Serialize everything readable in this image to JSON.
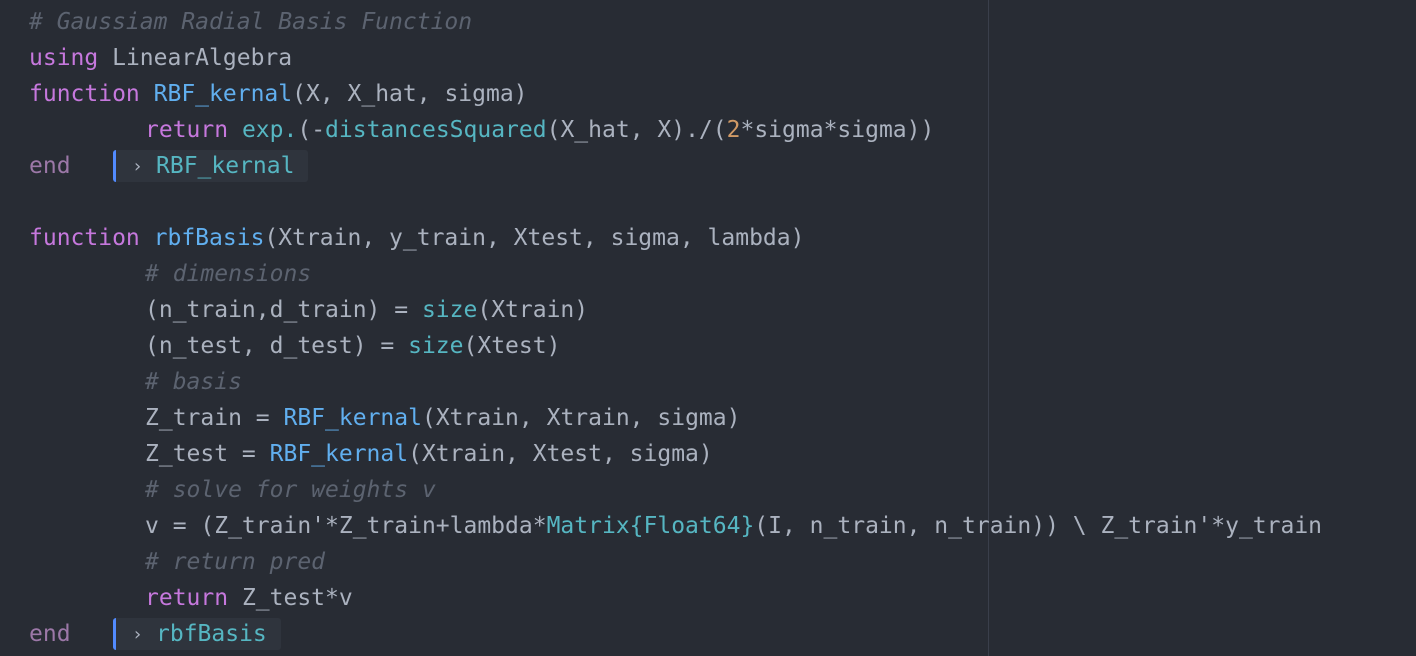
{
  "code": {
    "l1": {
      "comment": "# Gaussiam Radial Basis Function"
    },
    "l2": {
      "kw": "using",
      "rest": " LinearAlgebra"
    },
    "l3": {
      "kw": "function",
      "fn": "RBF_kernal",
      "args": "(X, X_hat, sigma)"
    },
    "l4": {
      "kw": "return",
      "f1": "exp.",
      "p1": "(-",
      "f2": "distancesSquared",
      "p2": "(X_hat, X)./(",
      "num": "2",
      "p3": "*sigma*sigma))"
    },
    "l5": {
      "kw": "end",
      "result": "RBF_kernal"
    },
    "l7": {
      "kw": "function",
      "fn": "rbfBasis",
      "args": "(Xtrain, y_train, Xtest, sigma, lambda)"
    },
    "l8": {
      "comment": "# dimensions"
    },
    "l9": {
      "p1": "(n_train,d_train) = ",
      "fn": "size",
      "p2": "(Xtrain)"
    },
    "l10": {
      "p1": "(n_test, d_test) = ",
      "fn": "size",
      "p2": "(Xtest)"
    },
    "l11": {
      "comment": "# basis"
    },
    "l12": {
      "p1": "Z_train = ",
      "fn": "RBF_kernal",
      "p2": "(Xtrain, Xtrain, sigma)"
    },
    "l13": {
      "p1": "Z_test = ",
      "fn": "RBF_kernal",
      "p2": "(Xtrain, Xtest, sigma)"
    },
    "l14": {
      "comment": "# solve for weights v"
    },
    "l15": {
      "p1": "v = (Z_train'*Z_train+lambda*",
      "t1": "Matrix",
      "t2": "{Float64}",
      "p2": "(I, n_train, n_train)) \\ Z_train'*y_train"
    },
    "l16": {
      "comment": "# return pred"
    },
    "l17": {
      "kw": "return",
      "rest": " Z_test*v"
    },
    "l18": {
      "kw": "end",
      "result": "rbfBasis"
    }
  },
  "colors": {
    "background": "#282c34",
    "keyword": "#c678dd",
    "function": "#61afef",
    "builtin": "#56b6c2",
    "number": "#d19a66",
    "comment": "#5c6370",
    "result_accent": "#528bff"
  },
  "icons": {
    "result_expand": "chevron-right-icon"
  }
}
